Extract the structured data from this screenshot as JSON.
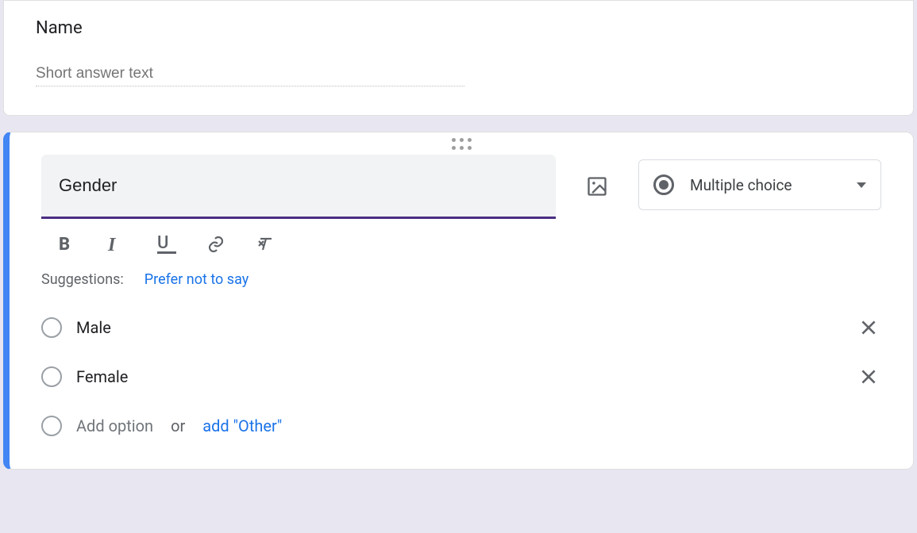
{
  "card1": {
    "title": "Name",
    "placeholder": "Short answer text"
  },
  "card2": {
    "question": "Gender",
    "type_label": "Multiple choice",
    "suggestions_label": "Suggestions:",
    "suggestion": "Prefer not to say",
    "options": [
      {
        "label": "Male"
      },
      {
        "label": "Female"
      }
    ],
    "add_option_hint": "Add option",
    "or_word": "or",
    "add_other": "add \"Other\""
  }
}
